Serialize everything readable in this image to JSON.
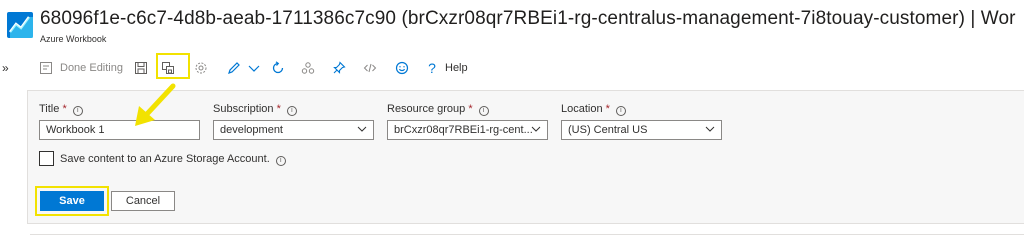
{
  "header": {
    "title": "68096f1e-c6c7-4d8b-aeab-1711386c7c90 (brCxzr08qr7RBEi1-rg-centralus-management-7i8touay-customer) | Wor",
    "subtitle": "Azure Workbook"
  },
  "sidebar": {
    "expand_glyph": "»"
  },
  "toolbar": {
    "done_label": "Done Editing",
    "help_label": "Help",
    "icons": [
      "edit-done-icon",
      "save-icon",
      "save-as-icon",
      "settings-icon",
      "pencil-icon",
      "chevron-down-icon",
      "refresh-icon",
      "share-icon",
      "pin-icon",
      "code-icon",
      "smiley-icon",
      "help-icon"
    ]
  },
  "form": {
    "title": {
      "label": "Title",
      "required_mark": "*",
      "value": "Workbook 1"
    },
    "subscription": {
      "label": "Subscription",
      "required_mark": "*",
      "value": "development"
    },
    "resource_group": {
      "label": "Resource group",
      "required_mark": "*",
      "value": "brCxzr08qr7RBEi1-rg-cent..."
    },
    "location": {
      "label": "Location",
      "required_mark": "*",
      "value": "(US) Central US"
    },
    "storage_checkbox": {
      "label": "Save content to an Azure Storage Account.",
      "checked": false
    },
    "save_label": "Save",
    "cancel_label": "Cancel"
  },
  "colors": {
    "accent": "#0078d4",
    "highlight": "#f2e200",
    "required": "#a4262c"
  }
}
